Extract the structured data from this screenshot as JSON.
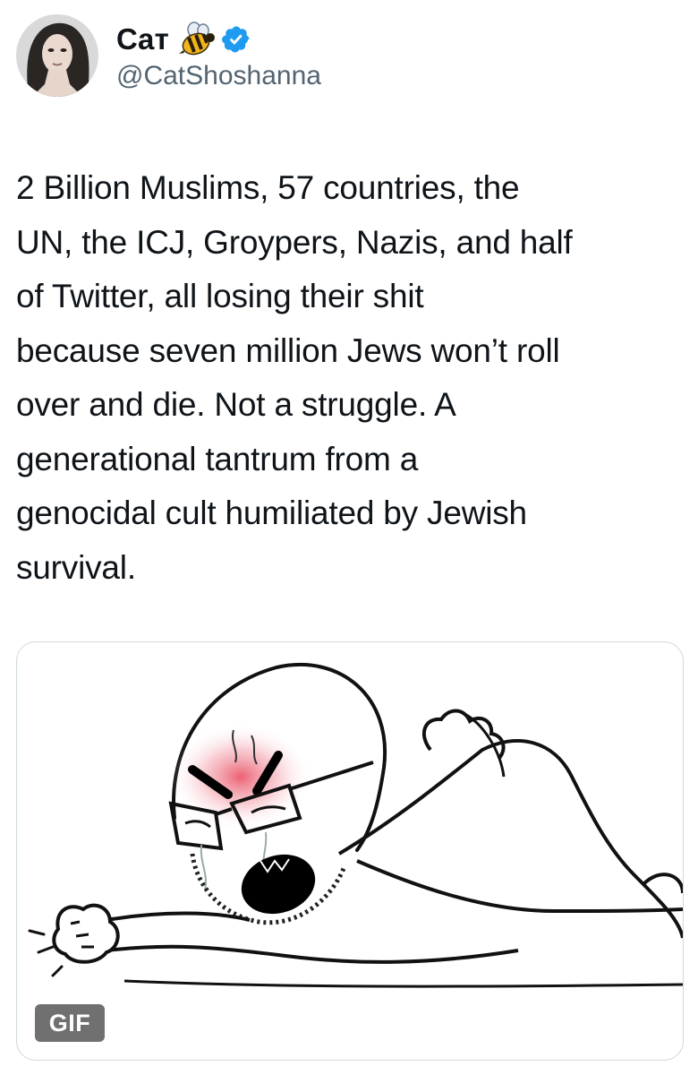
{
  "user": {
    "display_name": "Cат",
    "handle": "@CatShoshanna",
    "emoji_icon": "bee-icon",
    "verified_icon": "verified-badge-icon",
    "verified_color": "#1d9bf0"
  },
  "tweet": {
    "text": "2 Billion Muslims, 57 countries, the\nUN, the ICJ, Groypers, Nazis, and half\nof Twitter, all losing their shit\nbecause seven million Jews won’t roll\nover and die. Not a struggle. A\ngenerational tantrum from a\ngenocidal cult humiliated by Jewish\nsurvival."
  },
  "media": {
    "type": "gif",
    "badge_label": "GIF",
    "description_icon": "angry-wojak-cartoon-icon"
  },
  "colors": {
    "text": "#0f1419",
    "secondary_text": "#536471",
    "border": "#cfd9de",
    "gif_badge": "#707070"
  }
}
